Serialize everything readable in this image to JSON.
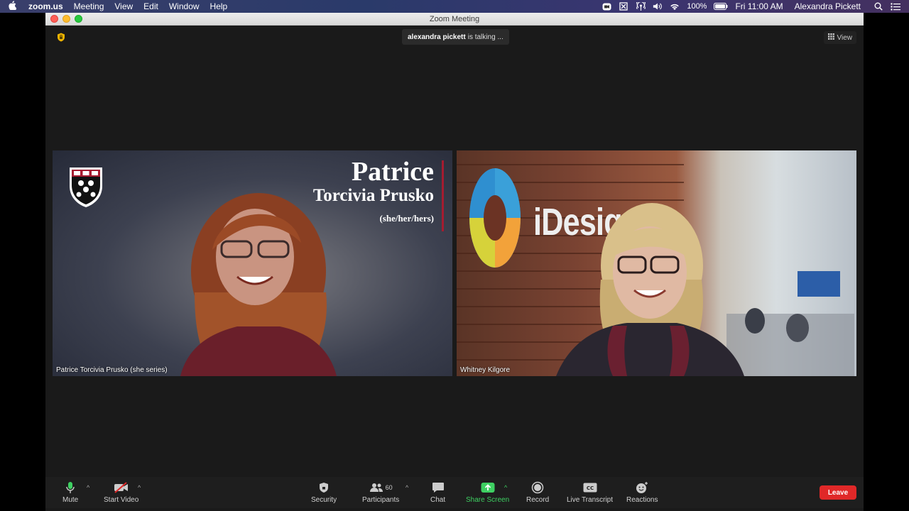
{
  "menubar": {
    "app_name": "zoom.us",
    "items": [
      "Meeting",
      "View",
      "Edit",
      "Window",
      "Help"
    ],
    "battery": "100%",
    "clock": "Fri 11:00 AM",
    "user": "Alexandra Pickett"
  },
  "window": {
    "title": "Zoom Meeting"
  },
  "meeting": {
    "talking_name": "alexandra pickett",
    "talking_suffix": "is talking ...",
    "view_label": "View"
  },
  "tiles": [
    {
      "name": "Patrice Torcivia Prusko (she series)",
      "overlay_first": "Patrice",
      "overlay_last": "Torcivia Prusko",
      "overlay_pronouns": "(she/her/hers)"
    },
    {
      "name": "Whitney Kilgore",
      "sign_text": "iDesign"
    }
  ],
  "toolbar": {
    "mute": "Mute",
    "start_video": "Start Video",
    "security": "Security",
    "participants": "Participants",
    "participants_count": "60",
    "chat": "Chat",
    "share_screen": "Share Screen",
    "record": "Record",
    "live_transcript": "Live Transcript",
    "reactions": "Reactions",
    "leave": "Leave"
  },
  "colors": {
    "share_green": "#3ed062",
    "leave_red": "#e02828",
    "harvard_crimson": "#a51c30"
  }
}
